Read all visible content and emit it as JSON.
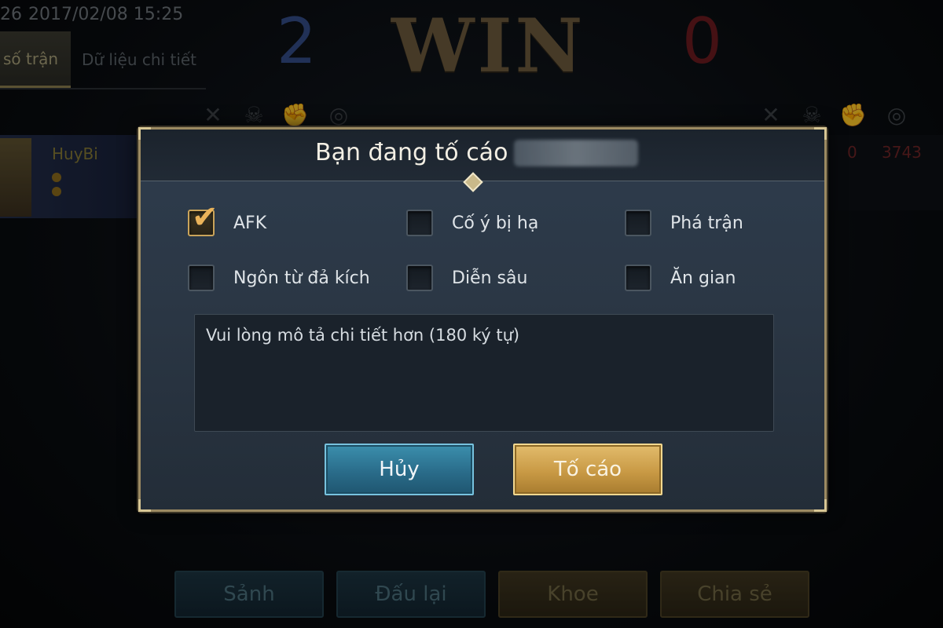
{
  "background": {
    "match_id_fragment": "26",
    "datetime": "2017/02/08 15:25",
    "tabs": [
      {
        "label": "số trận",
        "active": true
      },
      {
        "label": "Dữ liệu chi tiết",
        "active": false
      }
    ],
    "score_left": "2",
    "score_right": "0",
    "result": "WIN",
    "player_name": "HuyBi",
    "right_kills": "0",
    "right_gold": "3743",
    "bottom_buttons": [
      {
        "label": "Sảnh",
        "style": "blue"
      },
      {
        "label": "Đấu lại",
        "style": "blue"
      },
      {
        "label": "Khoe",
        "style": "gold"
      },
      {
        "label": "Chia sẻ",
        "style": "gold"
      }
    ]
  },
  "modal": {
    "title": "Bạn đang tố cáo",
    "options": [
      {
        "label": "AFK",
        "checked": true
      },
      {
        "label": "Cố ý bị hạ",
        "checked": false
      },
      {
        "label": "Phá trận",
        "checked": false
      },
      {
        "label": "Ngôn từ đả kích",
        "checked": false
      },
      {
        "label": "Diễn sâu",
        "checked": false
      },
      {
        "label": "Ăn gian",
        "checked": false
      }
    ],
    "description_placeholder": "Vui lòng mô tả chi tiết hơn (180 ký tự)",
    "cancel_label": "Hủy",
    "report_label": "Tố cáo"
  },
  "colors": {
    "accent_gold": "#c99a45",
    "accent_blue": "#2a6c8a",
    "check_color": "#eab35a",
    "team_blue": "#344c86",
    "team_red": "#6a1b1f"
  }
}
